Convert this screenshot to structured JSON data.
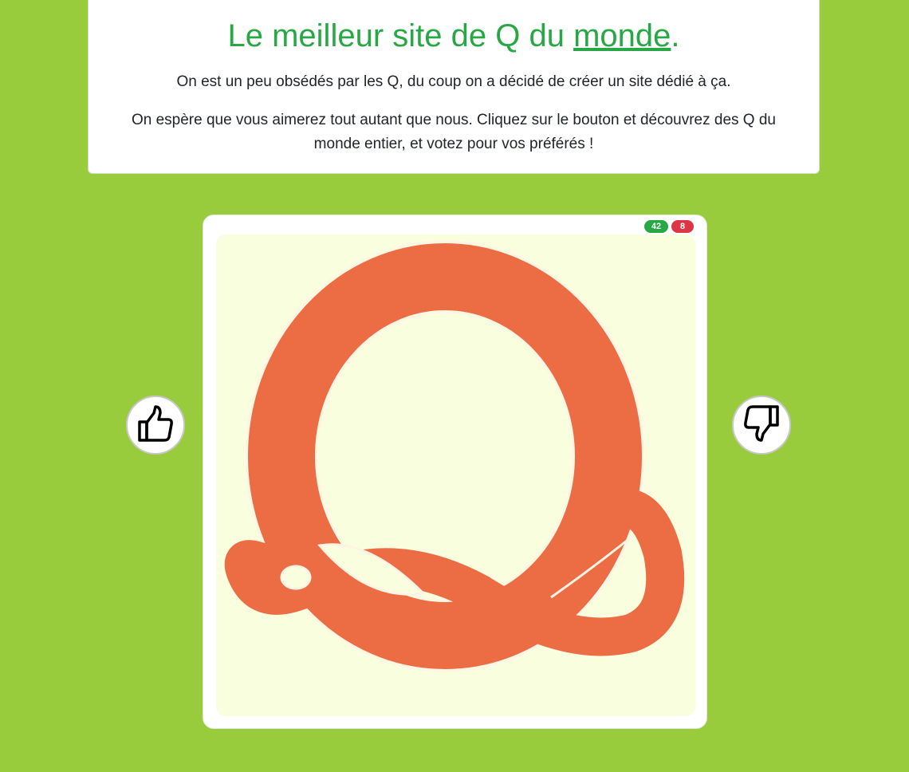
{
  "header": {
    "title_prefix": "Le meilleur site de Q du ",
    "title_link": "monde",
    "title_suffix": ".",
    "intro": "On est un peu obsédés par les Q, du coup on a décidé de créer un site dédié à ça.",
    "intro2": "On espère que vous aimerez tout autant que nous. Cliquez sur le bouton et découvrez des Q du monde entier, et votez pour vos préférés !"
  },
  "card": {
    "upvotes": "42",
    "downvotes": "8",
    "image_icon": "letter-q-illustration"
  },
  "buttons": {
    "like_icon": "thumbs-up-icon",
    "dislike_icon": "thumbs-down-icon"
  },
  "colors": {
    "background": "#99cc3c",
    "accent": "#28a745",
    "down_badge": "#dc3545",
    "letter": "#ec6d44",
    "image_bg": "#f9fede"
  }
}
